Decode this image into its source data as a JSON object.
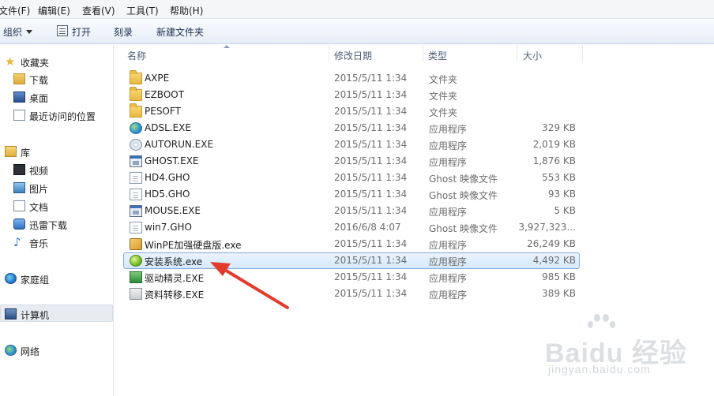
{
  "menu": [
    {
      "label": "文件(F)"
    },
    {
      "label": "编辑(E)"
    },
    {
      "label": "查看(V)"
    },
    {
      "label": "工具(T)"
    },
    {
      "label": "帮助(H)"
    }
  ],
  "toolbar": {
    "organize_label": "组织",
    "open_label": "打开",
    "burn_label": "刻录",
    "new_folder_label": "新建文件夹"
  },
  "columns": {
    "name": "名称",
    "date": "修改日期",
    "type": "类型",
    "size": "大小"
  },
  "nav": {
    "favorites": "收藏夹",
    "downloads": "下载",
    "desktop": "桌面",
    "recent": "最近访问的位置",
    "libraries": "库",
    "videos": "视频",
    "pictures": "图片",
    "documents": "文档",
    "thunder": "迅雷下载",
    "music": "音乐",
    "homegroup": "家庭组",
    "computer": "计算机",
    "network": "网络"
  },
  "files": [
    {
      "name": "AXPE",
      "date": "2015/5/11 1:34",
      "type": "文件夹",
      "size": "",
      "icon": "folder-icon"
    },
    {
      "name": "EZBOOT",
      "date": "2015/5/11 1:34",
      "type": "文件夹",
      "size": "",
      "icon": "folder-icon"
    },
    {
      "name": "PESOFT",
      "date": "2015/5/11 1:34",
      "type": "文件夹",
      "size": "",
      "icon": "folder-icon"
    },
    {
      "name": "ADSL.EXE",
      "date": "2015/5/11 1:34",
      "type": "应用程序",
      "size": "329 KB",
      "icon": "globe-app-icon"
    },
    {
      "name": "AUTORUN.EXE",
      "date": "2015/5/11 1:34",
      "type": "应用程序",
      "size": "2,019 KB",
      "icon": "cd-app-icon"
    },
    {
      "name": "GHOST.EXE",
      "date": "2015/5/11 1:34",
      "type": "应用程序",
      "size": "1,876 KB",
      "icon": "window-app-icon"
    },
    {
      "name": "HD4.GHO",
      "date": "2015/5/11 1:34",
      "type": "Ghost 映像文件",
      "size": "553 KB",
      "icon": "document-icon"
    },
    {
      "name": "HD5.GHO",
      "date": "2015/5/11 1:34",
      "type": "Ghost 映像文件",
      "size": "93 KB",
      "icon": "document-icon"
    },
    {
      "name": "MOUSE.EXE",
      "date": "2015/5/11 1:34",
      "type": "应用程序",
      "size": "5 KB",
      "icon": "window-app-icon"
    },
    {
      "name": "win7.GHO",
      "date": "2016/6/8 4:07",
      "type": "Ghost 映像文件",
      "size": "3,927,323...",
      "icon": "document-icon"
    },
    {
      "name": "WinPE加强硬盘版.exe",
      "date": "2015/5/11 1:34",
      "type": "应用程序",
      "size": "26,249 KB",
      "icon": "tool-app-icon"
    },
    {
      "name": "安装系统.exe",
      "date": "2015/5/11 1:34",
      "type": "应用程序",
      "size": "4,492 KB",
      "icon": "setup-app-icon"
    },
    {
      "name": "驱动精灵.EXE",
      "date": "2015/5/11 1:34",
      "type": "应用程序",
      "size": "985 KB",
      "icon": "driver-app-icon"
    },
    {
      "name": "资料转移.EXE",
      "date": "2015/5/11 1:34",
      "type": "应用程序",
      "size": "389 KB",
      "icon": "transfer-app-icon"
    }
  ],
  "selected_file_index": 11,
  "colors": {
    "selection_border": "#84acdd",
    "selection_fill": "#d6e9fc",
    "annotation_arrow": "#e23b2e"
  },
  "watermark": {
    "brand": "Bai",
    "brand_suffix": "du",
    "product": "经验",
    "url": "jingyan.baidu.com"
  }
}
